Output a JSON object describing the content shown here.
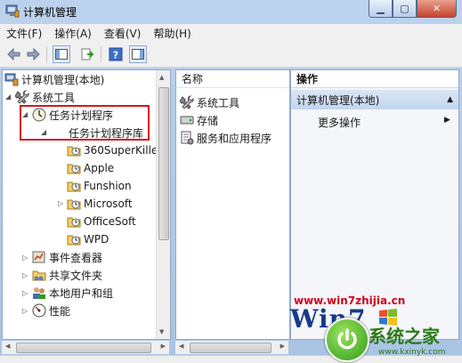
{
  "window": {
    "title": "计算机管理",
    "minimize_glyph": "▁",
    "maximize_glyph": "▢",
    "close_glyph": "✕"
  },
  "menu": [
    "文件(F)",
    "操作(A)",
    "查看(V)",
    "帮助(H)"
  ],
  "toolbar": {
    "icons": [
      "back-arrow-icon",
      "forward-arrow-icon",
      "show-tree-icon",
      "export-list-icon",
      "help-icon",
      "show-action-pane-icon"
    ]
  },
  "tree": {
    "root": "计算机管理(本地)",
    "system_tools": "系统工具",
    "task_scheduler": "任务计划程序",
    "task_library": "任务计划程序库",
    "tasks": [
      "360SuperKille",
      "Apple",
      "Funshion",
      "Microsoft",
      "OfficeSoft",
      "WPD"
    ],
    "event_viewer": "事件查看器",
    "shared_folders": "共享文件夹",
    "local_users": "本地用户和组",
    "performance": "性能"
  },
  "list": {
    "column": "名称",
    "items": [
      "系统工具",
      "存储",
      "服务和应用程序"
    ]
  },
  "actions": {
    "title": "操作",
    "selected": "计算机管理(本地)",
    "more": "更多操作"
  },
  "watermark": {
    "url": "www.win7zhijia.cn",
    "brand": "Win7",
    "cn": "系统之家",
    "url2": "www.kxinyk.com"
  },
  "colors": {
    "highlight_box": "#d7161a",
    "title_bg": "#bcd2ec",
    "close_button": "#c4432b"
  }
}
